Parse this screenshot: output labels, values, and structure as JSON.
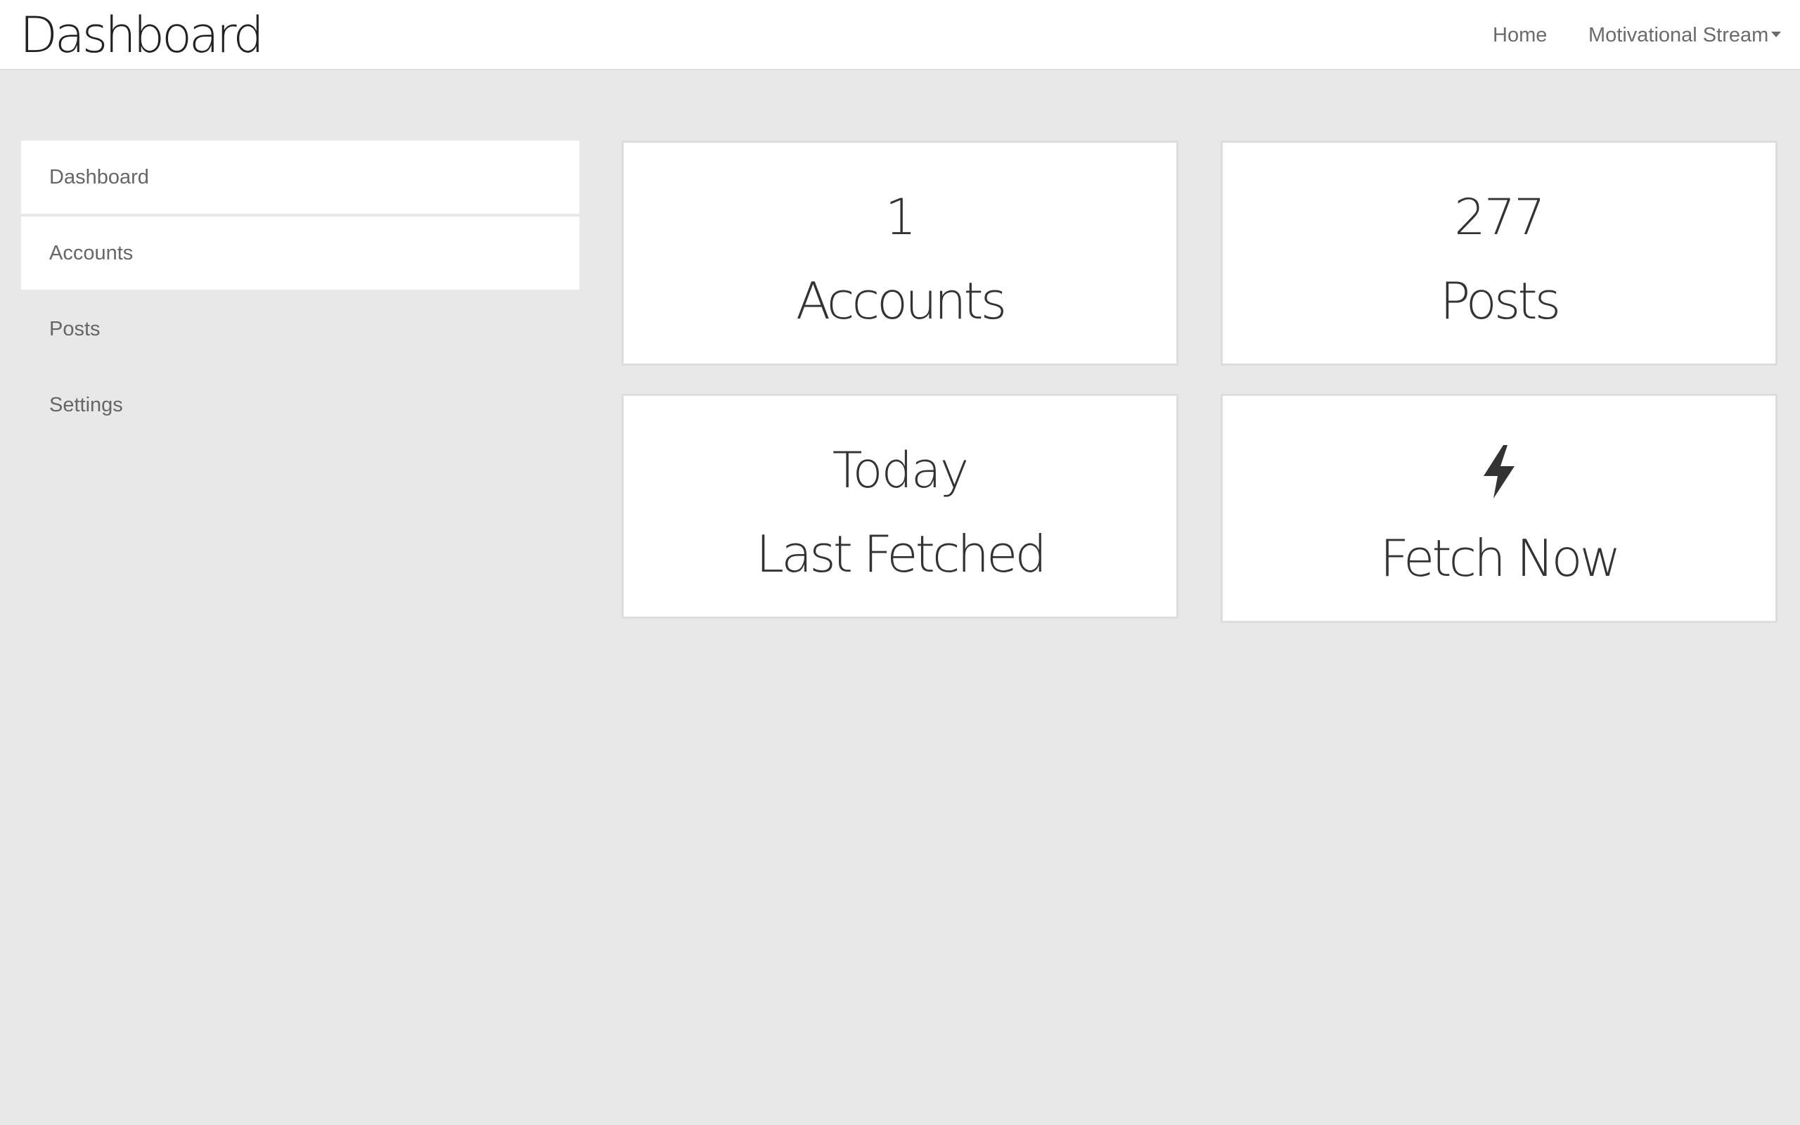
{
  "header": {
    "title": "Dashboard",
    "nav": {
      "home_label": "Home",
      "stream_label": "Motivational Stream"
    }
  },
  "sidebar": {
    "items": [
      {
        "label": "Dashboard",
        "active": true
      },
      {
        "label": "Accounts",
        "active": true
      },
      {
        "label": "Posts",
        "active": false
      },
      {
        "label": "Settings",
        "active": false
      }
    ]
  },
  "stats": {
    "accounts": {
      "value": "1",
      "label": "Accounts"
    },
    "posts": {
      "value": "277",
      "label": "Posts"
    },
    "last_fetched": {
      "value": "Today",
      "label": "Last Fetched"
    },
    "fetch_now": {
      "icon": "lightning-bolt-icon",
      "label": "Fetch Now"
    }
  },
  "colors": {
    "background": "#e8e8e8",
    "panel": "#ffffff",
    "text": "#333333",
    "muted_text": "#6b6b6b"
  }
}
